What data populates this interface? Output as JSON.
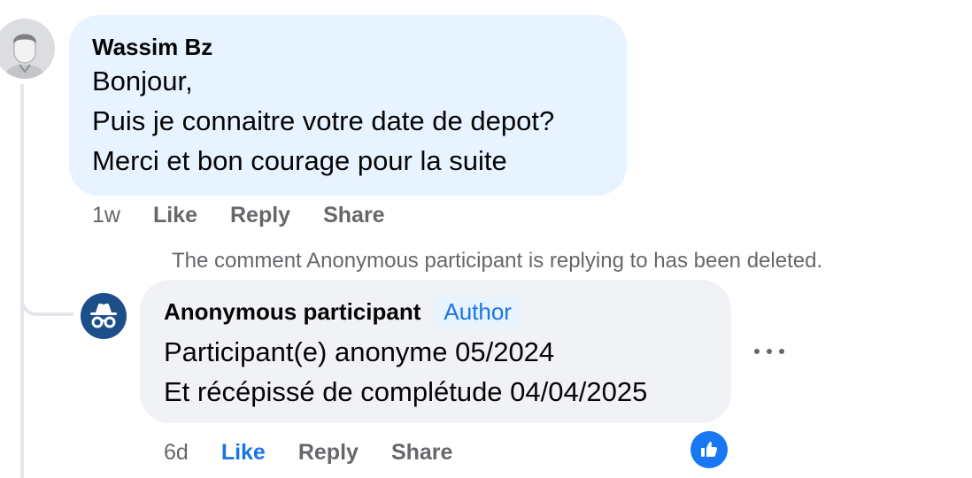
{
  "comment": {
    "author": "Wassim Bz",
    "lines": [
      "Bonjour,",
      "Puis je connaitre votre date de depot?",
      "Merci et bon courage pour la suite"
    ],
    "time": "1w",
    "like_label": "Like",
    "reply_label": "Reply",
    "share_label": "Share"
  },
  "deleted_notice": "The comment Anonymous participant is replying to has been deleted.",
  "reply": {
    "author": "Anonymous participant",
    "badge": "Author",
    "lines": [
      "Participant(e) anonyme 05/2024",
      "Et récépissé de complétude 04/04/2025"
    ],
    "time": "6d",
    "like_label": "Like",
    "reply_label": "Reply",
    "share_label": "Share",
    "liked": true,
    "reaction_icon": "thumbs-up-icon"
  },
  "colors": {
    "accent": "#1b74e4",
    "comment_bubble": "#e7f3ff",
    "reply_bubble": "#f0f2f5",
    "anon_avatar": "#1c4e89",
    "muted_text": "#65676b"
  }
}
